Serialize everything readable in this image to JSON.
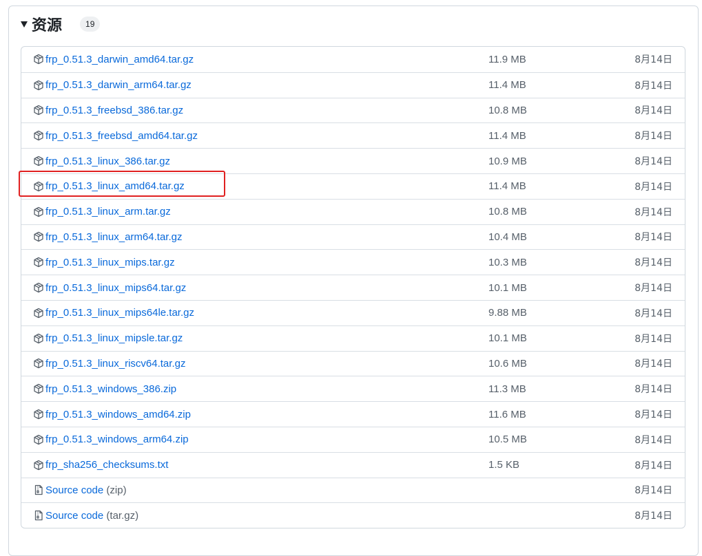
{
  "assets": {
    "title": "资源",
    "count": "19",
    "items": [
      {
        "name": "frp_0.51.3_darwin_amd64.tar.gz",
        "size": "11.9 MB",
        "date": "8月14日",
        "icon": "package-icon"
      },
      {
        "name": "frp_0.51.3_darwin_arm64.tar.gz",
        "size": "11.4 MB",
        "date": "8月14日",
        "icon": "package-icon"
      },
      {
        "name": "frp_0.51.3_freebsd_386.tar.gz",
        "size": "10.8 MB",
        "date": "8月14日",
        "icon": "package-icon"
      },
      {
        "name": "frp_0.51.3_freebsd_amd64.tar.gz",
        "size": "11.4 MB",
        "date": "8月14日",
        "icon": "package-icon"
      },
      {
        "name": "frp_0.51.3_linux_386.tar.gz",
        "size": "10.9 MB",
        "date": "8月14日",
        "icon": "package-icon"
      },
      {
        "name": "frp_0.51.3_linux_amd64.tar.gz",
        "size": "11.4 MB",
        "date": "8月14日",
        "icon": "package-icon"
      },
      {
        "name": "frp_0.51.3_linux_arm.tar.gz",
        "size": "10.8 MB",
        "date": "8月14日",
        "icon": "package-icon"
      },
      {
        "name": "frp_0.51.3_linux_arm64.tar.gz",
        "size": "10.4 MB",
        "date": "8月14日",
        "icon": "package-icon"
      },
      {
        "name": "frp_0.51.3_linux_mips.tar.gz",
        "size": "10.3 MB",
        "date": "8月14日",
        "icon": "package-icon"
      },
      {
        "name": "frp_0.51.3_linux_mips64.tar.gz",
        "size": "10.1 MB",
        "date": "8月14日",
        "icon": "package-icon"
      },
      {
        "name": "frp_0.51.3_linux_mips64le.tar.gz",
        "size": "9.88 MB",
        "date": "8月14日",
        "icon": "package-icon"
      },
      {
        "name": "frp_0.51.3_linux_mipsle.tar.gz",
        "size": "10.1 MB",
        "date": "8月14日",
        "icon": "package-icon"
      },
      {
        "name": "frp_0.51.3_linux_riscv64.tar.gz",
        "size": "10.6 MB",
        "date": "8月14日",
        "icon": "package-icon"
      },
      {
        "name": "frp_0.51.3_windows_386.zip",
        "size": "11.3 MB",
        "date": "8月14日",
        "icon": "package-icon"
      },
      {
        "name": "frp_0.51.3_windows_amd64.zip",
        "size": "11.6 MB",
        "date": "8月14日",
        "icon": "package-icon"
      },
      {
        "name": "frp_0.51.3_windows_arm64.zip",
        "size": "10.5 MB",
        "date": "8月14日",
        "icon": "package-icon"
      },
      {
        "name": "frp_sha256_checksums.txt",
        "size": "1.5 KB",
        "date": "8月14日",
        "icon": "package-icon"
      },
      {
        "name": "Source code",
        "suffix": "(zip)",
        "size": "",
        "date": "8月14日",
        "icon": "file-zip-icon"
      },
      {
        "name": "Source code",
        "suffix": "(tar.gz)",
        "size": "",
        "date": "8月14日",
        "icon": "file-zip-icon"
      }
    ]
  },
  "colors": {
    "link": "#0969da",
    "muted": "#57606a",
    "border": "#d0d7de",
    "highlight": "#e02020"
  }
}
